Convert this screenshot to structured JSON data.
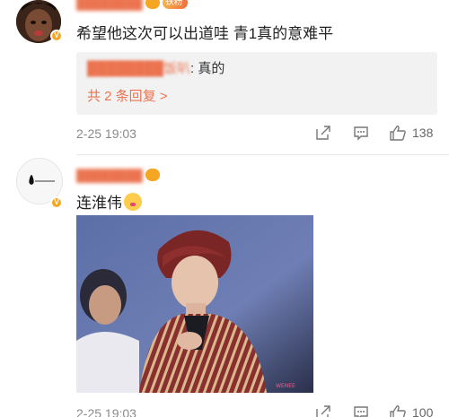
{
  "comment1": {
    "username": "████████",
    "fan_badge": "铁粉",
    "text": "希望他这次可以出道哇 青1真的意难平",
    "replies": {
      "first_user": "████████饭叭",
      "first_text": ": 真的",
      "more_label": "共 2 条回复 >"
    },
    "time": "2-25 19:03",
    "like_count": "138"
  },
  "comment2": {
    "username": "████████",
    "text": "连淮伟",
    "time": "2-25 19:03",
    "like_count": "100"
  },
  "colors": {
    "accent": "#eb7350",
    "fan_badge": "#f5a623",
    "reply_bg": "#f2f2f2",
    "meta_gray": "#8a8a8a"
  },
  "icons": [
    "share-icon",
    "comment-icon",
    "like-icon",
    "verified-badge-icon",
    "emoji-icon"
  ]
}
